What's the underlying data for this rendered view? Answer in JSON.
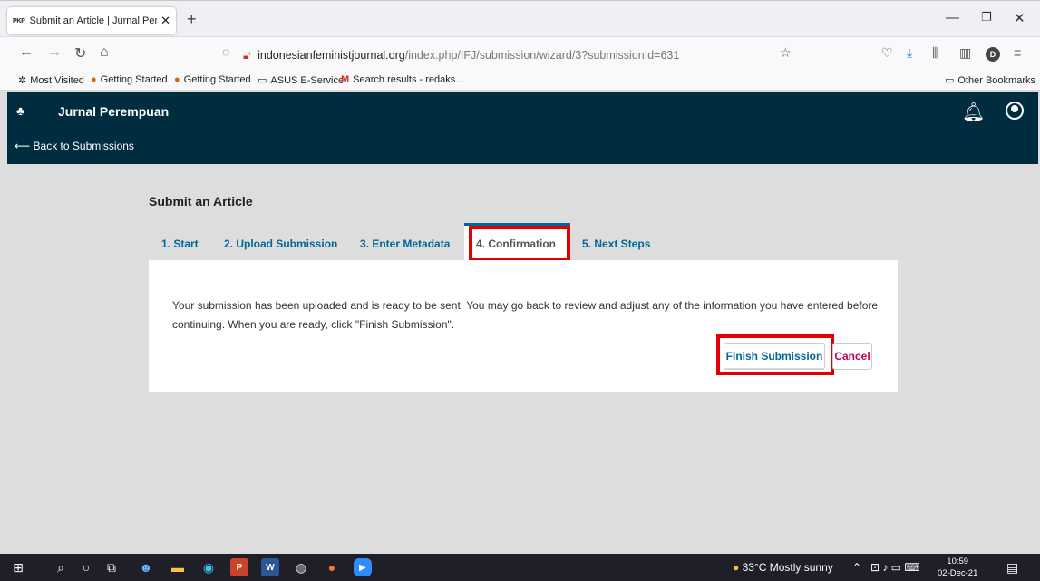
{
  "browser": {
    "tab_favicon": "PKP",
    "tab_title": "Submit an Article | Jurnal Perem",
    "url_host": "indonesianfeministjournal.org",
    "url_path": "/index.php/IFJ/submission/wizard/3?submissionId=631",
    "profile_initial": "D",
    "bookmarks": [
      "Most Visited",
      "Getting Started",
      "Getting Started",
      "ASUS E-Service",
      "Search results - redaks..."
    ],
    "other_bookmarks": "Other Bookmarks"
  },
  "header": {
    "site_name": "Jurnal Perempuan",
    "back_link": "Back to Submissions"
  },
  "page": {
    "title": "Submit an Article",
    "tabs": [
      {
        "label": "1. Start"
      },
      {
        "label": "2. Upload Submission"
      },
      {
        "label": "3. Enter Metadata"
      },
      {
        "label": "4. Confirmation"
      },
      {
        "label": "5. Next Steps"
      }
    ],
    "message": "Your submission has been uploaded and is ready to be sent. You may go back to review and adjust any of the information you have entered before continuing. When you are ready, click \"Finish Submission\".",
    "finish_label": "Finish Submission",
    "cancel_label": "Cancel"
  },
  "taskbar": {
    "weather": "33°C  Mostly sunny",
    "time": "10:59",
    "date": "02-Dec-21"
  },
  "colors": {
    "header_bg": "#002c40",
    "link_blue": "#006798",
    "cancel_pink": "#c10057",
    "highlight_red": "#e00000"
  }
}
